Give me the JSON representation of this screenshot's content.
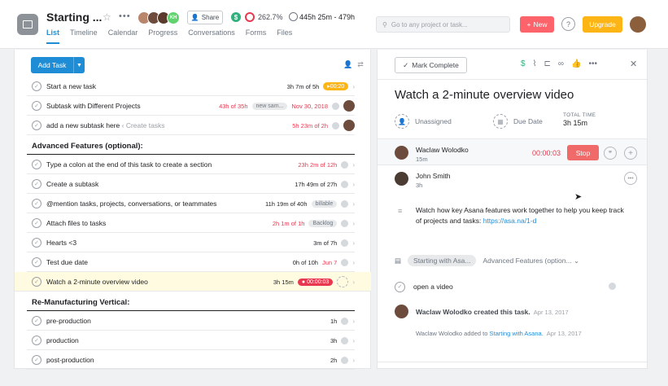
{
  "project": {
    "title": "Starting ...",
    "share_label": "Share",
    "progress_percent": "262.7%",
    "time_summary": "445h 25m - 479h",
    "avatar_initials": "KH",
    "tabs": [
      "List",
      "Timeline",
      "Calendar",
      "Progress",
      "Conversations",
      "Forms",
      "Files"
    ]
  },
  "top": {
    "search_placeholder": "Go to any project or task...",
    "new_label": "New",
    "help_label": "?",
    "upgrade_label": "Upgrade"
  },
  "list": {
    "add_task_label": "Add Task",
    "rows": [
      {
        "type": "task",
        "name": "Start a new task",
        "time": "3h 7m of 5h",
        "time_color": "dark",
        "timer": "00:20"
      },
      {
        "type": "task",
        "name": "Subtask with Different Projects",
        "time": "43h of 35h",
        "time_color": "red",
        "tag": "new sam...",
        "due": "Nov 30, 2018",
        "avatar": true
      },
      {
        "type": "task",
        "name": "add a new subtask here",
        "sub": "‹ Create tasks",
        "time": "5h 23m of 2h",
        "time_color": "red",
        "avatar": true
      },
      {
        "type": "section",
        "name": "Advanced Features (optional):"
      },
      {
        "type": "task",
        "name": "Type a colon at the end of this task to create a section",
        "time": "23h 2m of 12h",
        "time_color": "red"
      },
      {
        "type": "task",
        "name": "Create a subtask",
        "time": "17h 49m of 27h",
        "time_color": "dark"
      },
      {
        "type": "task",
        "name": "@mention tasks, projects, conversations, or teammates",
        "time": "11h 19m of 40h",
        "time_color": "dark",
        "tag": "billable"
      },
      {
        "type": "task",
        "name": "Attach files to tasks",
        "time": "2h 1m of 1h",
        "time_color": "red",
        "tag": "Backlog"
      },
      {
        "type": "task",
        "name": "Hearts <3",
        "time": "3m of 7h",
        "time_color": "dark"
      },
      {
        "type": "task",
        "name": "Test due date",
        "time": "0h of 10h",
        "time_color": "dark",
        "due": "Jun 7"
      },
      {
        "type": "task",
        "name": "Watch a 2-minute overview video",
        "time": "3h 15m",
        "time_color": "dark",
        "timer_red": "00:00:03",
        "highlight": true
      },
      {
        "type": "section",
        "name": "Re-Manufacturing Vertical:"
      },
      {
        "type": "task",
        "name": "pre-production",
        "time": "1h",
        "time_color": "dark"
      },
      {
        "type": "task",
        "name": "production",
        "time": "3h",
        "time_color": "dark"
      },
      {
        "type": "task",
        "name": "post-production",
        "time": "2h",
        "time_color": "dark"
      }
    ]
  },
  "detail": {
    "mark_complete_label": "Mark Complete",
    "title": "Watch a 2-minute overview video",
    "assignee_label": "Unassigned",
    "due_label": "Due Date",
    "total_time_label": "TOTAL TIME",
    "total_time_value": "3h 15m",
    "trackers": [
      {
        "name": "Waclaw Wolodko",
        "duration": "15m",
        "counter": "00:00:03",
        "stop_label": "Stop"
      },
      {
        "name": "John Smith",
        "duration": "3h"
      }
    ],
    "description_text": "Watch how key Asana features work together to help you keep track of projects and tasks: ",
    "description_link": "https://asa.na/1-d",
    "project_pill": "Starting with Asa...",
    "section_select": "Advanced Features (option...",
    "subtask": "open a video",
    "story_created": "Waclaw Wolodko created this task.",
    "story_created_date": "Apr 13, 2017",
    "story_added_prefix": "Waclaw Wolodko added to",
    "story_added_link": "Starting with Asana.",
    "story_added_date": "Apr 13, 2017"
  },
  "colors": {
    "accent": "#1f8dd6",
    "new_button": "#fc636b",
    "upgrade_button": "#fdb515",
    "stop_button": "#f06a6a",
    "overdue": "#e8384f",
    "highlight_row": "#fffbe0"
  }
}
